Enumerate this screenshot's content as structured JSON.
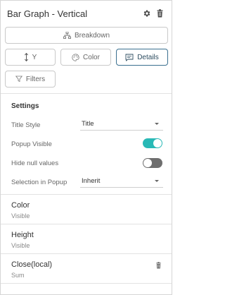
{
  "header": {
    "title": "Bar Graph - Vertical",
    "icons": [
      "gear-icon",
      "trash-icon"
    ]
  },
  "buttons": {
    "breakdown": "Breakdown",
    "y": "Y",
    "color": "Color",
    "details": "Details",
    "filters": "Filters"
  },
  "settings": {
    "title": "Settings",
    "title_style_label": "Title Style",
    "title_style_value": "Title",
    "popup_visible_label": "Popup Visible",
    "popup_visible_on": true,
    "hide_null_label": "Hide null values",
    "hide_null_on": false,
    "selection_popup_label": "Selection in Popup",
    "selection_popup_value": "Inherit"
  },
  "fields": [
    {
      "name": "Color",
      "sub": "Visible"
    },
    {
      "name": "Height",
      "sub": "Visible"
    },
    {
      "name": "Close(local)",
      "sub": "Sum"
    }
  ],
  "colors": {
    "accent": "#29b9b6",
    "active_border": "#3a6f8f",
    "toggle_off": "#6e6e6e"
  }
}
